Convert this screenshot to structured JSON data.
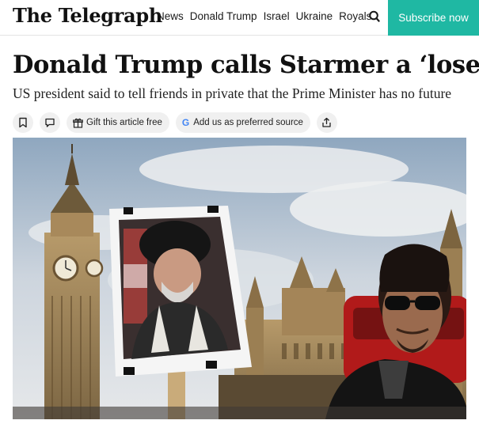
{
  "header": {
    "logo_text": "The Telegraph",
    "nav_items": [
      "News",
      "Donald Trump",
      "Israel",
      "Ukraine",
      "Royals"
    ],
    "search_icon": "search-icon",
    "subscribe_label": "Subscribe now",
    "subscribe_color": "#1fb8a3"
  },
  "article": {
    "headline": "Donald Trump calls Starmer a ‘loser’",
    "standfirst": "US president said to tell friends in private that the Prime Minister has no future",
    "actions": {
      "bookmark_icon": "bookmark-icon",
      "comment_icon": "comment-icon",
      "gift_label": "Gift this article free",
      "gift_icon": "gift-icon",
      "source_label": "Add us as preferred source",
      "google_letter": "G",
      "share_icon": "share-icon"
    }
  }
}
